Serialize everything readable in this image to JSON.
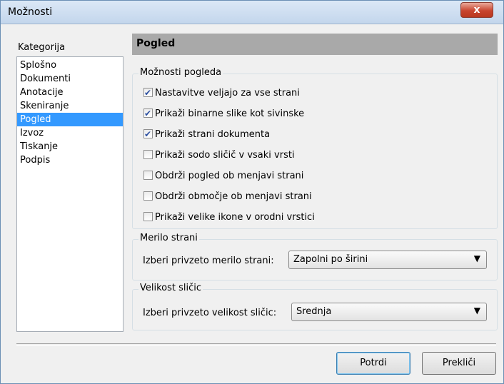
{
  "window": {
    "title": "Možnosti",
    "close_label": "x"
  },
  "category": {
    "label": "Kategorija",
    "items": [
      "Splošno",
      "Dokumenti",
      "Anotacije",
      "Skeniranje",
      "Pogled",
      "Izvoz",
      "Tiskanje",
      "Podpis"
    ],
    "selected": "Pogled"
  },
  "panel": {
    "title": "Pogled"
  },
  "view_options": {
    "legend": "Možnosti pogleda",
    "options": [
      {
        "label": "Nastavitve veljajo za vse strani",
        "checked": true
      },
      {
        "label": "Prikaži binarne slike kot sivinske",
        "checked": true
      },
      {
        "label": "Prikaži strani dokumenta",
        "checked": true
      },
      {
        "label": "Prikaži sodo sličič v vsaki vrsti",
        "checked": false
      },
      {
        "label": "Obdrži pogled ob menjavi strani",
        "checked": false
      },
      {
        "label": "Obdrži območje ob menjavi strani",
        "checked": false
      },
      {
        "label": "Prikaži velike ikone v orodni vrstici",
        "checked": false
      }
    ]
  },
  "page_scale": {
    "legend": "Merilo strani",
    "label": "Izberi privzeto merilo strani:",
    "value": "Zapolni po širini",
    "arrow_icon": "▼"
  },
  "thumb_size": {
    "legend": "Velikost sličic",
    "label": "Izberi privzeto velikost sličic:",
    "value": "Srednja",
    "arrow_icon": "▼"
  },
  "buttons": {
    "ok": "Potrdi",
    "cancel": "Prekliči"
  }
}
